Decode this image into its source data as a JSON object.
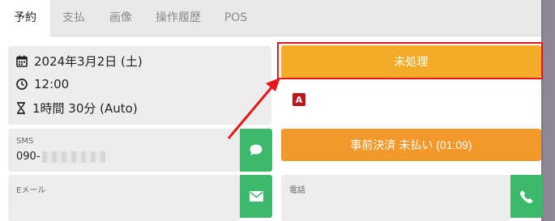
{
  "tabs": [
    {
      "label": "予約"
    },
    {
      "label": "支払"
    },
    {
      "label": "画像"
    },
    {
      "label": "操作履歴"
    },
    {
      "label": "POS"
    }
  ],
  "booking": {
    "date": "2024年3月2日 (土)",
    "time": "12:00",
    "duration": "1時間 30分 (Auto)"
  },
  "status_button": {
    "label": "未処理"
  },
  "annotation_marker": {
    "label": "A"
  },
  "prepay_button": {
    "label": "事前決済 未払い (01:09)"
  },
  "sms": {
    "label": "SMS",
    "value_prefix": "090-"
  },
  "email": {
    "label": "Eメール",
    "value": ""
  },
  "phone": {
    "label": "電話",
    "value": ""
  },
  "colors": {
    "status_orange": "#f4ab27",
    "prepay_orange": "#f3982a",
    "action_green": "#3cba6b",
    "highlight_red": "#e8161c"
  },
  "icons": [
    "calendar-icon",
    "clock-icon",
    "hourglass-icon",
    "chat-bubble-icon",
    "mail-icon",
    "phone-icon"
  ]
}
